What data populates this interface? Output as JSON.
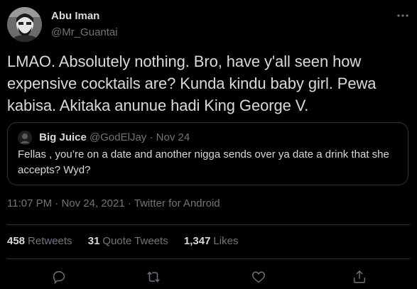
{
  "tweet": {
    "author": {
      "name": "Abu Iman",
      "handle": "@Mr_Guantai"
    },
    "text": "LMAO. Absolutely nothing. Bro, have y'all seen how expensive cocktails are? Kunda kindu baby girl. Pewa kabisa. Akitaka anunue hadi King George V.",
    "quoted": {
      "name": "Big Juice",
      "handle": "@GodElJay",
      "separator": "·",
      "date": "Nov 24",
      "text": "Fellas , you’re on a date and another nigga sends over ya date a drink that she accepts? Wyd?"
    },
    "timestamp": {
      "time": "11:07 PM",
      "date": "Nov 24, 2021",
      "separator": "·",
      "source": "Twitter for Android"
    },
    "stats": {
      "retweets": {
        "count": "458",
        "label": "Retweets"
      },
      "quotes": {
        "count": "31",
        "label": "Quote Tweets"
      },
      "likes": {
        "count": "1,347",
        "label": "Likes"
      }
    },
    "actions": [
      "reply-icon",
      "retweet-icon",
      "like-icon",
      "share-icon"
    ]
  },
  "colors": {
    "background": "#000000",
    "text": "#d9d9d9",
    "secondary": "#6e767d",
    "border": "#2f3336"
  }
}
